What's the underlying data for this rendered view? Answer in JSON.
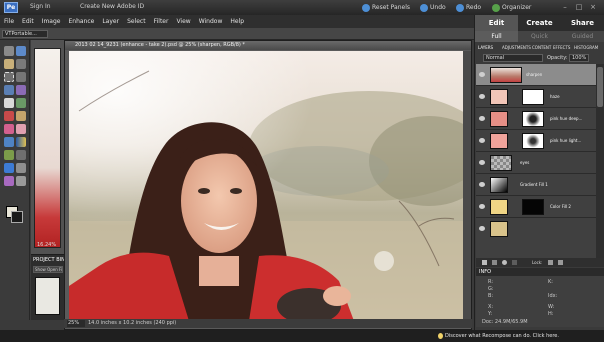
{
  "app": {
    "signin_label": "Sign In",
    "create_id_label": "Create New Adobe ID",
    "toolbar": {
      "reset_panels": "Reset Panels",
      "undo": "Undo",
      "redo": "Redo",
      "organizer": "Organizer"
    }
  },
  "menu": [
    "File",
    "Edit",
    "Image",
    "Enhance",
    "Layer",
    "Select",
    "Filter",
    "View",
    "Window",
    "Help"
  ],
  "options_bar": {
    "preset": "VTPortable..."
  },
  "doc_strip": {
    "zoom": "16.24%"
  },
  "project_bin": {
    "title": "PROJECT BIN",
    "show_label": "Show Open Files"
  },
  "document": {
    "title": "2013 02 14_9231 (enhance - take 2).psd @ 25% (sharpen, RGB/8) *",
    "zoom": "25%",
    "status": "14.0 inches x 10.2 inches (240 ppi)"
  },
  "panel": {
    "modes": [
      "Edit",
      "Create",
      "Share"
    ],
    "subtabs": [
      "Full",
      "Quick",
      "Guided"
    ],
    "panel_tabs": [
      "LAYERS",
      "ADJUSTMENTS",
      "CONTENT",
      "EFFECTS",
      "HISTOGRAM"
    ],
    "blend_mode": "Normal",
    "opacity_label": "Opacity:",
    "opacity_value": "100%",
    "lock_label": "Lock:",
    "layers": [
      {
        "name": "sharpen",
        "selected": true
      },
      {
        "name": "haze",
        "selected": false
      },
      {
        "name": "pink hue deep...",
        "selected": false
      },
      {
        "name": "pink hue light...",
        "selected": false
      },
      {
        "name": "eyes",
        "selected": false
      },
      {
        "name": "Gradient Fill 1",
        "selected": false
      },
      {
        "name": "Color Fill 2",
        "selected": false
      }
    ]
  },
  "info": {
    "title": "INFO",
    "r": "R:",
    "g": "G:",
    "b": "B:",
    "k": "K:",
    "idx": "Idx:",
    "x": "X:",
    "y": "Y:",
    "w": "W:",
    "h": "H:",
    "doc": "Doc: 24.9M/65.9M"
  },
  "footer": {
    "tip": "Discover what Recompose can do. Click here."
  },
  "colors": {
    "accent": "#4d8fd6",
    "foreground_swatch": "#e8e5d8",
    "background_swatch": "#1a1a1a",
    "selected_layer": "#8c8c8c"
  }
}
